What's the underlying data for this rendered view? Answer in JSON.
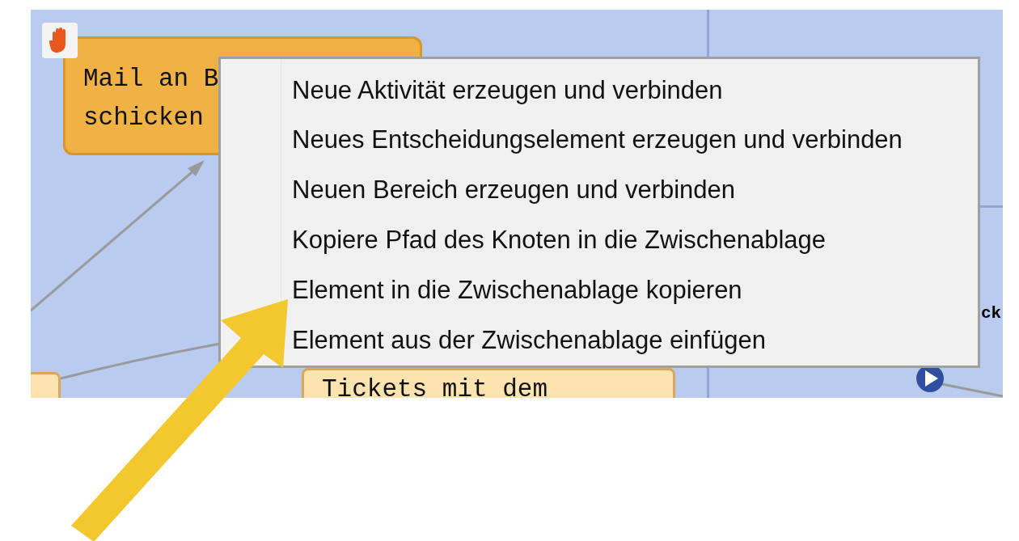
{
  "canvas": {
    "nodes": [
      {
        "kind": "activity",
        "lines": [
          "Mail an B",
          "schicken"
        ]
      },
      {
        "kind": "note",
        "lines": [
          "Tickets mit dem"
        ]
      },
      {
        "kind": "stub"
      },
      {
        "kind": "label",
        "lines": [
          "ck"
        ]
      }
    ]
  },
  "context_menu": {
    "items": [
      {
        "label": "Neue Aktivität erzeugen und verbinden"
      },
      {
        "label": "Neues Entscheidungselement erzeugen und verbinden"
      },
      {
        "label": "Neuen Bereich erzeugen und verbinden"
      },
      {
        "label": "Kopiere Pfad des Knoten in die Zwischenablage"
      },
      {
        "label": "Element in die Zwischenablage kopieren"
      },
      {
        "label": "Element aus der Zwischenablage einfügen"
      }
    ]
  }
}
